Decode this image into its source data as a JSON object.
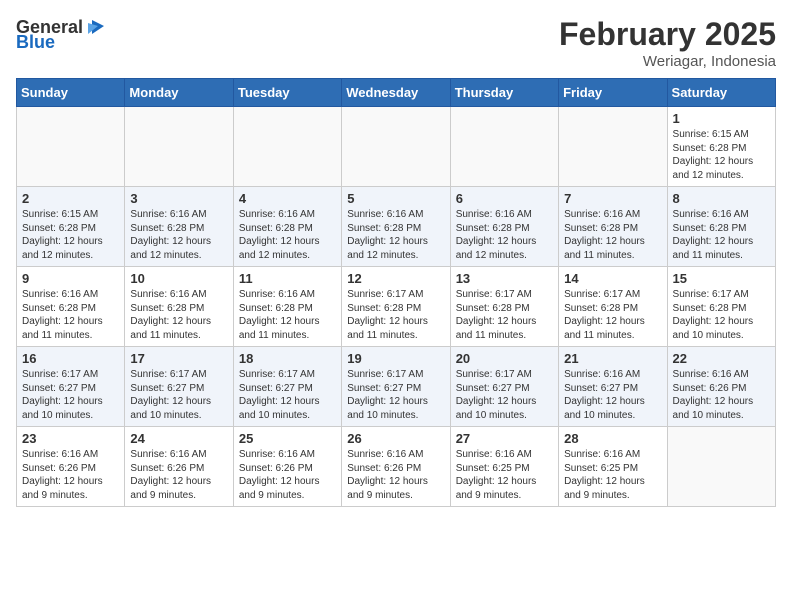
{
  "header": {
    "logo_general": "General",
    "logo_blue": "Blue",
    "month": "February 2025",
    "location": "Weriagar, Indonesia"
  },
  "weekdays": [
    "Sunday",
    "Monday",
    "Tuesday",
    "Wednesday",
    "Thursday",
    "Friday",
    "Saturday"
  ],
  "weeks": [
    [
      {
        "day": "",
        "info": ""
      },
      {
        "day": "",
        "info": ""
      },
      {
        "day": "",
        "info": ""
      },
      {
        "day": "",
        "info": ""
      },
      {
        "day": "",
        "info": ""
      },
      {
        "day": "",
        "info": ""
      },
      {
        "day": "1",
        "info": "Sunrise: 6:15 AM\nSunset: 6:28 PM\nDaylight: 12 hours\nand 12 minutes."
      }
    ],
    [
      {
        "day": "2",
        "info": "Sunrise: 6:15 AM\nSunset: 6:28 PM\nDaylight: 12 hours\nand 12 minutes."
      },
      {
        "day": "3",
        "info": "Sunrise: 6:16 AM\nSunset: 6:28 PM\nDaylight: 12 hours\nand 12 minutes."
      },
      {
        "day": "4",
        "info": "Sunrise: 6:16 AM\nSunset: 6:28 PM\nDaylight: 12 hours\nand 12 minutes."
      },
      {
        "day": "5",
        "info": "Sunrise: 6:16 AM\nSunset: 6:28 PM\nDaylight: 12 hours\nand 12 minutes."
      },
      {
        "day": "6",
        "info": "Sunrise: 6:16 AM\nSunset: 6:28 PM\nDaylight: 12 hours\nand 12 minutes."
      },
      {
        "day": "7",
        "info": "Sunrise: 6:16 AM\nSunset: 6:28 PM\nDaylight: 12 hours\nand 11 minutes."
      },
      {
        "day": "8",
        "info": "Sunrise: 6:16 AM\nSunset: 6:28 PM\nDaylight: 12 hours\nand 11 minutes."
      }
    ],
    [
      {
        "day": "9",
        "info": "Sunrise: 6:16 AM\nSunset: 6:28 PM\nDaylight: 12 hours\nand 11 minutes."
      },
      {
        "day": "10",
        "info": "Sunrise: 6:16 AM\nSunset: 6:28 PM\nDaylight: 12 hours\nand 11 minutes."
      },
      {
        "day": "11",
        "info": "Sunrise: 6:16 AM\nSunset: 6:28 PM\nDaylight: 12 hours\nand 11 minutes."
      },
      {
        "day": "12",
        "info": "Sunrise: 6:17 AM\nSunset: 6:28 PM\nDaylight: 12 hours\nand 11 minutes."
      },
      {
        "day": "13",
        "info": "Sunrise: 6:17 AM\nSunset: 6:28 PM\nDaylight: 12 hours\nand 11 minutes."
      },
      {
        "day": "14",
        "info": "Sunrise: 6:17 AM\nSunset: 6:28 PM\nDaylight: 12 hours\nand 11 minutes."
      },
      {
        "day": "15",
        "info": "Sunrise: 6:17 AM\nSunset: 6:28 PM\nDaylight: 12 hours\nand 10 minutes."
      }
    ],
    [
      {
        "day": "16",
        "info": "Sunrise: 6:17 AM\nSunset: 6:27 PM\nDaylight: 12 hours\nand 10 minutes."
      },
      {
        "day": "17",
        "info": "Sunrise: 6:17 AM\nSunset: 6:27 PM\nDaylight: 12 hours\nand 10 minutes."
      },
      {
        "day": "18",
        "info": "Sunrise: 6:17 AM\nSunset: 6:27 PM\nDaylight: 12 hours\nand 10 minutes."
      },
      {
        "day": "19",
        "info": "Sunrise: 6:17 AM\nSunset: 6:27 PM\nDaylight: 12 hours\nand 10 minutes."
      },
      {
        "day": "20",
        "info": "Sunrise: 6:17 AM\nSunset: 6:27 PM\nDaylight: 12 hours\nand 10 minutes."
      },
      {
        "day": "21",
        "info": "Sunrise: 6:16 AM\nSunset: 6:27 PM\nDaylight: 12 hours\nand 10 minutes."
      },
      {
        "day": "22",
        "info": "Sunrise: 6:16 AM\nSunset: 6:26 PM\nDaylight: 12 hours\nand 10 minutes."
      }
    ],
    [
      {
        "day": "23",
        "info": "Sunrise: 6:16 AM\nSunset: 6:26 PM\nDaylight: 12 hours\nand 9 minutes."
      },
      {
        "day": "24",
        "info": "Sunrise: 6:16 AM\nSunset: 6:26 PM\nDaylight: 12 hours\nand 9 minutes."
      },
      {
        "day": "25",
        "info": "Sunrise: 6:16 AM\nSunset: 6:26 PM\nDaylight: 12 hours\nand 9 minutes."
      },
      {
        "day": "26",
        "info": "Sunrise: 6:16 AM\nSunset: 6:26 PM\nDaylight: 12 hours\nand 9 minutes."
      },
      {
        "day": "27",
        "info": "Sunrise: 6:16 AM\nSunset: 6:25 PM\nDaylight: 12 hours\nand 9 minutes."
      },
      {
        "day": "28",
        "info": "Sunrise: 6:16 AM\nSunset: 6:25 PM\nDaylight: 12 hours\nand 9 minutes."
      },
      {
        "day": "",
        "info": ""
      }
    ]
  ]
}
